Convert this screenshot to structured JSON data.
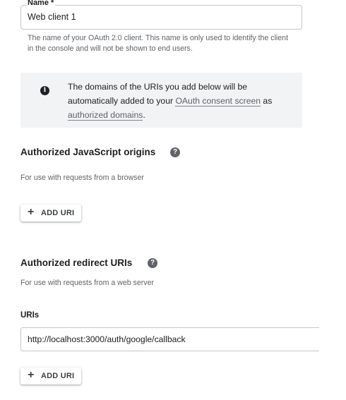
{
  "name_field": {
    "label": "Name *",
    "value": "Web client 1",
    "hint": "The name of your OAuth 2.0 client. This name is only used to identify the client in the console and will not be shown to end users."
  },
  "info_box": {
    "icon": "info-icon",
    "text_before": "The domains of the URIs you add below will be automatically added to your ",
    "link_consent": "OAuth consent screen",
    "text_middle": " as ",
    "link_domains": "authorized domains",
    "text_after": "."
  },
  "js_origins": {
    "title": "Authorized JavaScript origins",
    "help_icon": "help-icon",
    "description": "For use with requests from a browser",
    "add_button": "ADD URI"
  },
  "redirect_uris": {
    "title": "Authorized redirect URIs",
    "help_icon": "help-icon",
    "description": "For use with requests from a web server",
    "uris_label": "URIs",
    "uri_value": "http://localhost:3000/auth/google/callback",
    "add_button": "ADD URI"
  }
}
